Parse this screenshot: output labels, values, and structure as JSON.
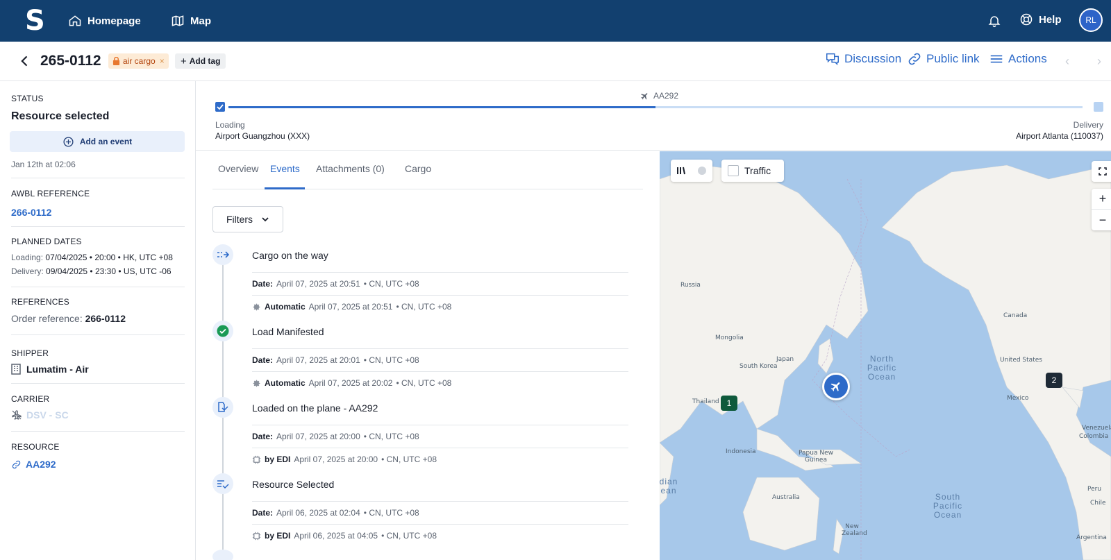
{
  "nav": {
    "logo": "S",
    "homepage": "Homepage",
    "map": "Map",
    "help": "Help",
    "avatar": "RL"
  },
  "header": {
    "shipment_id": "265-0112",
    "tag": "air cargo",
    "tag_close": "×",
    "add_tag": "Add tag",
    "discussion": "Discussion",
    "public_link": "Public link",
    "actions": "Actions",
    "prev": "‹",
    "next": "›"
  },
  "sidebar": {
    "status_label": "STATUS",
    "status_value": "Resource selected",
    "add_event": "Add an event",
    "status_date": "Jan 12th at 02:06",
    "awbl_label": "AWBL REFERENCE",
    "awbl_value": "266-0112",
    "planned_label": "PLANNED DATES",
    "loading_key": "Loading:",
    "loading_value": "07/04/2025 • 20:00 • HK, UTC +08",
    "delivery_key": "Delivery:",
    "delivery_value": "09/04/2025 • 23:30 • US, UTC -06",
    "references_label": "REFERENCES",
    "order_ref_key": "Order reference:",
    "order_ref_value": "266-0112",
    "shipper_label": "SHIPPER",
    "shipper_value": "Lumatim - Air",
    "carrier_label": "CARRIER",
    "carrier_value": "DSV - SC",
    "resource_label": "RESOURCE",
    "resource_value": "AA292"
  },
  "route": {
    "flight": "AA292",
    "progress": 0.5,
    "origin_label": "Loading",
    "origin_name": "Airport Guangzhou (XXX)",
    "dest_label": "Delivery",
    "dest_name": "Airport Atlanta (110037)"
  },
  "tabs": [
    {
      "label": "Overview"
    },
    {
      "label": "Events"
    },
    {
      "label": "Attachments (0)"
    },
    {
      "label": "Cargo"
    }
  ],
  "filters_label": "Filters",
  "events": [
    {
      "title": "Cargo on the way",
      "date_key": "Date:",
      "date_value": "April 07, 2025 at 20:51",
      "date_tz": "• CN, UTC +08",
      "source": "Automatic",
      "source_value": "April 07, 2025 at 20:51",
      "source_tz": "• CN, UTC +08"
    },
    {
      "title": "Load Manifested",
      "date_key": "Date:",
      "date_value": "April 07, 2025 at 20:01",
      "date_tz": "• CN, UTC +08",
      "source": "Automatic",
      "source_value": "April 07, 2025 at 20:02",
      "source_tz": "• CN, UTC +08"
    },
    {
      "title": "Loaded on the plane - AA292",
      "date_key": "Date:",
      "date_value": "April 07, 2025 at 20:00",
      "date_tz": "• CN, UTC +08",
      "source": "by EDI",
      "source_value": "April 07, 2025 at 20:00",
      "source_tz": "• CN, UTC +08"
    },
    {
      "title": "Resource Selected",
      "date_key": "Date:",
      "date_value": "April 06, 2025 at 02:04",
      "date_tz": "• CN, UTC +08",
      "source": "by EDI",
      "source_value": "April 06, 2025 at 04:05",
      "source_tz": "• CN, UTC +08"
    }
  ],
  "map": {
    "traffic": "Traffic",
    "zoom_in": "+",
    "zoom_out": "−",
    "marker1": "1",
    "marker2": "2",
    "labels": {
      "russia": "Russia",
      "mongolia": "Mongolia",
      "japan": "Japan",
      "south_korea": "South Korea",
      "thailand": "Thailand",
      "indonesia": "Indonesia",
      "papua": "Papua New Guinea",
      "australia": "Australia",
      "new_zealand": "New Zealand",
      "canada": "Canada",
      "united_states": "United States",
      "mexico": "Mexico",
      "venezuela": "Venezuela",
      "colombia": "Colombia",
      "peru": "Peru",
      "chile": "Chile",
      "argentina": "Argentina",
      "north_pacific": "North Pacific Ocean",
      "south_pacific": "South Pacific Ocean",
      "indian_ocean": "dian ean"
    }
  },
  "colors": {
    "nav_bg": "#12406f",
    "accent": "#2e6bc9",
    "map_water": "#a7c8ea",
    "marker_green": "#0f5a3c",
    "marker_dark": "#1e2a36"
  }
}
